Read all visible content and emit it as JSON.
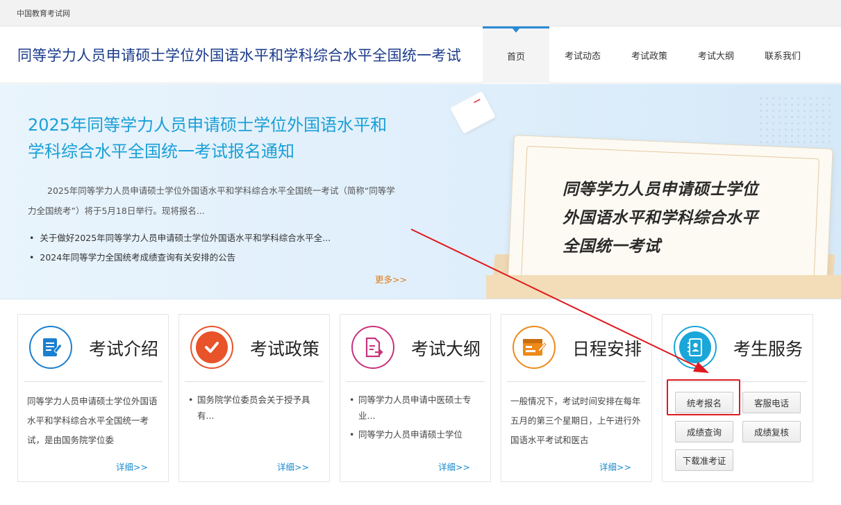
{
  "topbar": {
    "site_name": "中国教育考试网"
  },
  "header": {
    "title": "同等学力人员申请硕士学位外国语水平和学科综合水平全国统一考试",
    "nav": [
      "首页",
      "考试动态",
      "考试政策",
      "考试大纲",
      "联系我们"
    ],
    "active_nav": "首页"
  },
  "banner": {
    "headline_line1": "2025年同等学力人员申请硕士学位外国语水平和",
    "headline_line2": "学科综合水平全国统一考试报名通知",
    "summary": "2025年同等学力人员申请硕士学位外国语水平和学科综合水平全国统一考试（简称“同等学力全国统考”）将于5月18日举行。现将报名...",
    "news": [
      "关于做好2025年同等学力人员申请硕士学位外国语水平和学科综合水平全...",
      "2024年同等学力全国统考成绩查询有关安排的公告"
    ],
    "more": "更多>>",
    "illustration_text": [
      "同等学力人员申请硕士学位",
      "外国语水平和学科综合水平",
      "全国统一考试"
    ]
  },
  "cards": {
    "intro": {
      "title": "考试介绍",
      "desc": "同等学力人员申请硕士学位外国语水平和学科综合水平全国统一考试，是由国务院学位委",
      "detail": "详细>>",
      "icon": "document-edit-icon",
      "color": "#1a7fd0"
    },
    "policy": {
      "title": "考试政策",
      "items": [
        "国务院学位委员会关于授予具有..."
      ],
      "detail": "详细>>",
      "icon": "checkmark-icon",
      "color": "#e8532a"
    },
    "syllabus": {
      "title": "考试大纲",
      "items": [
        "同等学力人员申请中医硕士专业...",
        "同等学力人员申请硕士学位"
      ],
      "detail": "详细>>",
      "icon": "file-export-icon",
      "color": "#c8327d"
    },
    "schedule": {
      "title": "日程安排",
      "desc": "一般情况下，考试时间安排在每年五月的第三个星期日，上午进行外国语水平考试和医古",
      "detail": "详细>>",
      "icon": "calendar-board-icon",
      "color": "#ee8a1a"
    },
    "service": {
      "title": "考生服务",
      "icon": "contacts-book-icon",
      "color": "#1aa6d8",
      "buttons": [
        "统考报名",
        "客服电话",
        "成绩查询",
        "成绩复核",
        "下载准考证"
      ]
    }
  },
  "annotation": {
    "color": "#e0191e"
  }
}
